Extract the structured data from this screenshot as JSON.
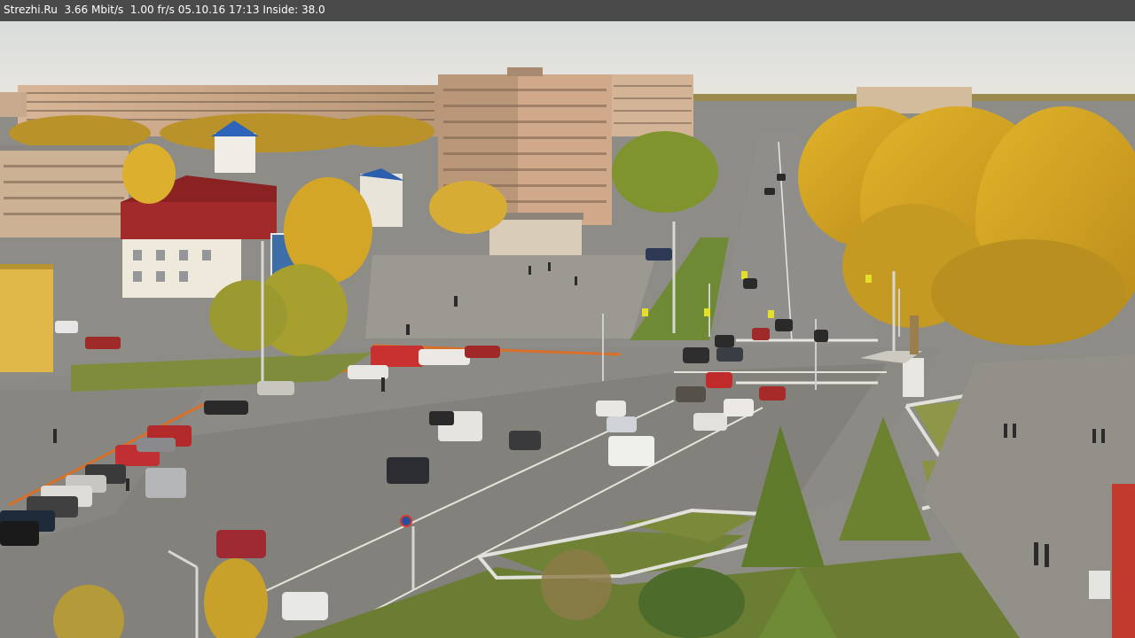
{
  "camera_overlay": {
    "text": "Strezhi.Ru  3.66 Mbit/s  1.00 fr/s 05.10.16 17:13 Inside: 38.0"
  },
  "scene": {
    "description_visible": false,
    "colors": {
      "sky": "#dfe2e1",
      "asphalt": "#8c8a85",
      "shadow": "#6b6b68",
      "building_beige": "#c9a889",
      "tree_gold": "#d4a21d",
      "grass": "#7a8a3a",
      "lane_mark": "#e8e8e0"
    },
    "vehicle_count_visible": 42
  }
}
